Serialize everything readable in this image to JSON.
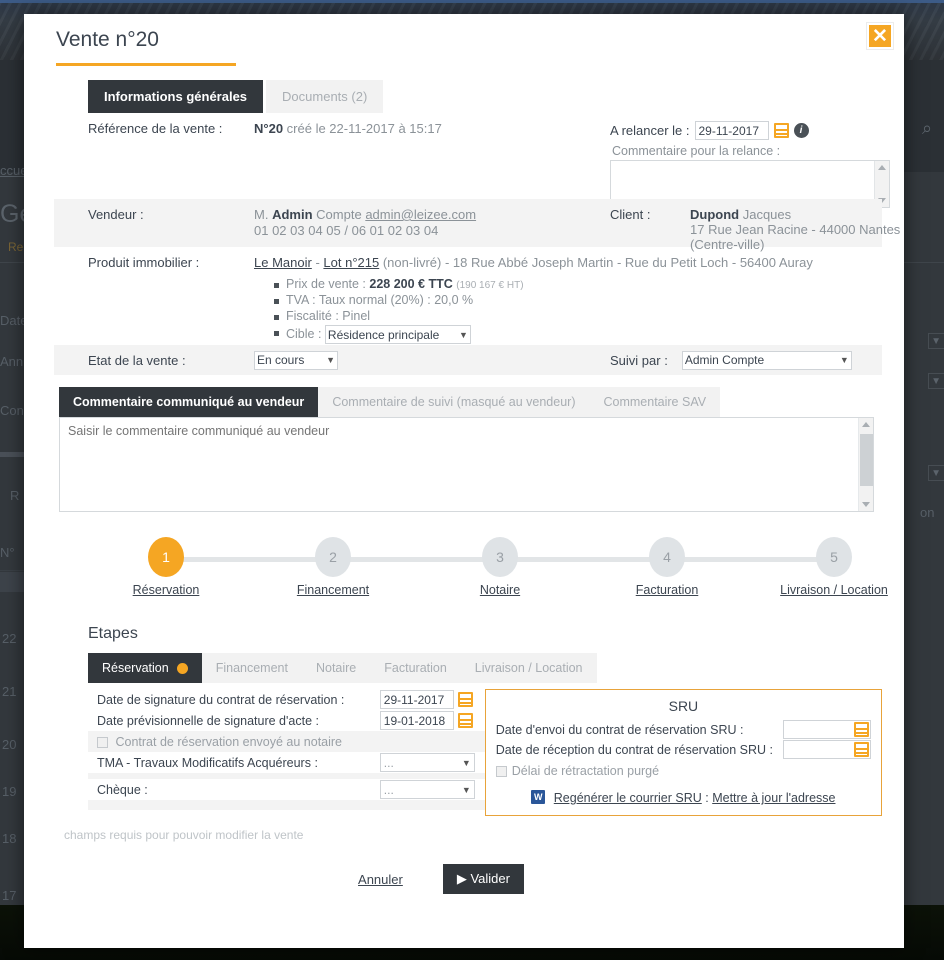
{
  "background": {
    "nav_home": "ccuei",
    "heading": "Ges",
    "sub": "Re",
    "f1": "Date",
    "f2": "Ann",
    "f3": "Con",
    "f4": "R",
    "col": "N°",
    "rows": [
      "22",
      "21",
      "20",
      "19",
      "18",
      "17"
    ]
  },
  "modal": {
    "title": "Vente n°20",
    "close_label": "✕",
    "tabs": [
      {
        "label": "Informations générales",
        "active": true
      },
      {
        "label": "Documents (2)",
        "active": false
      }
    ],
    "reference": {
      "label": "Référence de la vente :",
      "number": "N°20",
      "created": "créé le 22-11-2017 à 15:17"
    },
    "relance": {
      "label": "A relancer le :",
      "date": "29-11-2017",
      "calendar_icon": "calendar-icon",
      "info_icon": "info-icon",
      "comment_label": "Commentaire pour la relance :",
      "comment_value": "",
      "comment_placeholder": ""
    },
    "vendeur": {
      "label": "Vendeur :",
      "civility": "M.",
      "name": "Admin",
      "surname": "Compte",
      "email": "admin@leizee.com",
      "phones": "01 02 03 04 05  / 06 01 02 03 04"
    },
    "client": {
      "label": "Client :",
      "name": "Dupond",
      "surname": "Jacques",
      "address": "17 Rue Jean Racine - 44000 Nantes",
      "address2": "(Centre-ville)"
    },
    "produit": {
      "label": "Produit immobilier :",
      "programme": "Le Manoir",
      "lot": "Lot n°215",
      "status": "(non-livré)",
      "address": "- 18 Rue Abbé Joseph Martin - Rue du Petit Loch - 56400 Auray",
      "bullets": [
        {
          "label": "Prix de vente :",
          "value": "228 200 € TTC",
          "extra": "(190 167 € HT)"
        },
        {
          "label": "TVA : Taux normal (20%) : 20,0 %",
          "value": "",
          "extra": ""
        },
        {
          "label": "Fiscalité : Pinel",
          "value": "",
          "extra": ""
        }
      ],
      "cible_label": "Cible :",
      "cible_value": "Résidence principale"
    },
    "etat": {
      "label": "Etat de la vente :",
      "value": "En cours",
      "suivi_label": "Suivi par :",
      "suivi_value": "Admin Compte"
    },
    "comment_tabs": [
      {
        "label": "Commentaire communiqué au vendeur",
        "active": true
      },
      {
        "label": "Commentaire de suivi (masqué au vendeur)",
        "active": false
      },
      {
        "label": "Commentaire SAV",
        "active": false
      }
    ],
    "comment_textarea": {
      "value": "",
      "placeholder": "Saisir le commentaire communiqué au vendeur"
    },
    "stepper": [
      {
        "num": "1",
        "label": "Réservation",
        "active": true
      },
      {
        "num": "2",
        "label": "Financement",
        "active": false
      },
      {
        "num": "3",
        "label": "Notaire",
        "active": false
      },
      {
        "num": "4",
        "label": "Facturation",
        "active": false
      },
      {
        "num": "5",
        "label": "Livraison / Location",
        "active": false
      }
    ],
    "etapes": {
      "heading": "Etapes",
      "tabs": [
        {
          "label": "Réservation",
          "active": true
        },
        {
          "label": "Financement",
          "active": false
        },
        {
          "label": "Notaire",
          "active": false
        },
        {
          "label": "Facturation",
          "active": false
        },
        {
          "label": "Livraison / Location",
          "active": false
        }
      ],
      "fields": {
        "date_signature_label": "Date de signature du contrat de réservation :",
        "date_signature_value": "29-11-2017",
        "date_previsionnelle_label": "Date prévisionnelle de signature d'acte :",
        "date_previsionnelle_value": "19-01-2018",
        "contrat_envoye_label": "Contrat de réservation envoyé au notaire",
        "tma_label": "TMA - Travaux Modificatifs Acquéreurs :",
        "tma_value": "...",
        "cheque_label": "Chèque :",
        "cheque_value": "..."
      },
      "sru": {
        "title": "SRU",
        "envoi_label": "Date d'envoi du contrat de réservation SRU :",
        "envoi_value": "",
        "reception_label": "Date de réception du contrat de réservation SRU :",
        "reception_value": "",
        "delai_label": "Délai de rétractation purgé",
        "regenerer_link": "Regénérer le courrier SRU",
        "separator": " : ",
        "adresse_link": "Mettre à jour l'adresse"
      }
    },
    "note": "champs requis pour pouvoir modifier la vente",
    "actions": {
      "cancel": "Annuler",
      "validate": "▶ Valider"
    }
  },
  "colors": {
    "accent": "#f5a623",
    "dark": "#32373c",
    "muted": "#8b9298"
  }
}
